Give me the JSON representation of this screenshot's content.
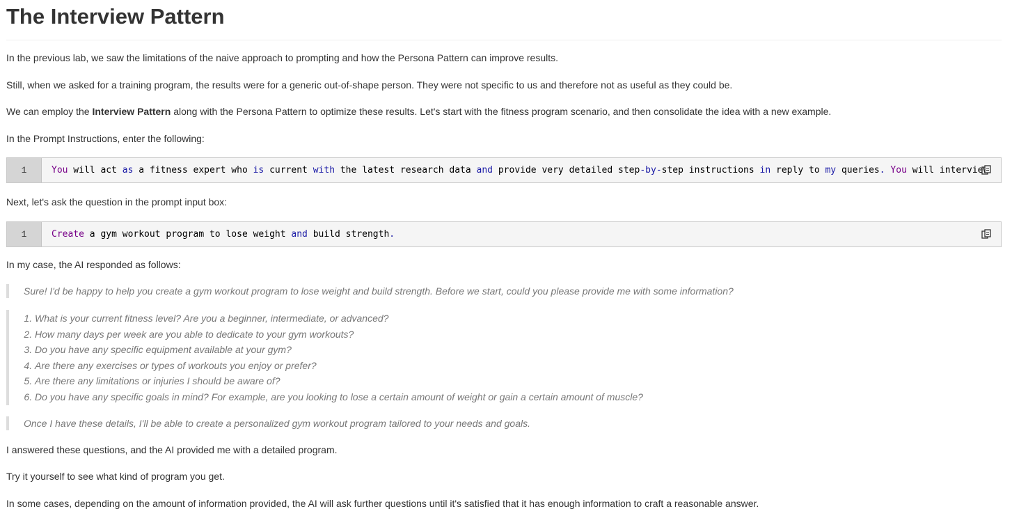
{
  "title": "The Interview Pattern",
  "paragraphs": {
    "p1": "In the previous lab, we saw the limitations of the naive approach to prompting and how the Persona Pattern can improve results.",
    "p2": "Still, when we asked for a training program, the results were for a generic out-of-shape person. They were not specific to us and therefore not as useful as they could be.",
    "p3_before": "We can employ the ",
    "p3_bold": "Interview Pattern",
    "p3_after": " along with the Persona Pattern to optimize these results. Let's start with the fitness program scenario, and then consolidate the idea with a new example.",
    "p4": "In the Prompt Instructions, enter the following:",
    "p5": "Next, let's ask the question in the prompt input box:",
    "p6": "In my case, the AI responded as follows:",
    "p7": "I answered these questions, and the AI provided me with a detailed program.",
    "p8": "Try it yourself to see what kind of program you get.",
    "p9": "In some cases, depending on the amount of information provided, the AI will ask further questions until it's satisfied that it has enough information to craft a reasonable answer."
  },
  "code_blocks": [
    {
      "line_number": "1",
      "tokens": [
        {
          "t": "You",
          "c": "kw1"
        },
        {
          "t": " will act ",
          "c": ""
        },
        {
          "t": "as",
          "c": "kw2"
        },
        {
          "t": " a fitness expert who ",
          "c": ""
        },
        {
          "t": "is",
          "c": "kw2"
        },
        {
          "t": " current ",
          "c": ""
        },
        {
          "t": "with",
          "c": "kw2"
        },
        {
          "t": " the latest research data ",
          "c": ""
        },
        {
          "t": "and",
          "c": "kw2"
        },
        {
          "t": " provide very detailed step",
          "c": ""
        },
        {
          "t": "-",
          "c": "kw2"
        },
        {
          "t": "by",
          "c": "kw2"
        },
        {
          "t": "-",
          "c": "kw2"
        },
        {
          "t": "step instructions ",
          "c": ""
        },
        {
          "t": "in",
          "c": "kw2"
        },
        {
          "t": " reply to ",
          "c": ""
        },
        {
          "t": "my",
          "c": "kw2"
        },
        {
          "t": " queries",
          "c": ""
        },
        {
          "t": ".",
          "c": "kw2"
        },
        {
          "t": " ",
          "c": ""
        },
        {
          "t": "You",
          "c": "kw1"
        },
        {
          "t": " will interview",
          "c": ""
        }
      ]
    },
    {
      "line_number": "1",
      "tokens": [
        {
          "t": "Create",
          "c": "kw1"
        },
        {
          "t": " a gym workout program to lose weight ",
          "c": ""
        },
        {
          "t": "and",
          "c": "kw2"
        },
        {
          "t": " build strength",
          "c": ""
        },
        {
          "t": ".",
          "c": "kw2"
        }
      ]
    }
  ],
  "response": {
    "intro": "Sure! I'd be happy to help you create a gym workout program to lose weight and build strength. Before we start, could you please provide me with some information?",
    "questions": [
      "What is your current fitness level? Are you a beginner, intermediate, or advanced?",
      "How many days per week are you able to dedicate to your gym workouts?",
      "Do you have any specific equipment available at your gym?",
      "Are there any exercises or types of workouts you enjoy or prefer?",
      "Are there any limitations or injuries I should be aware of?",
      "Do you have any specific goals in mind? For example, are you looking to lose a certain amount of weight or gain a certain amount of muscle?"
    ],
    "outro": "Once I have these details, I'll be able to create a personalized gym workout program tailored to your needs and goals."
  },
  "icons": {
    "copy": "copy-icon"
  },
  "colors": {
    "keyword_purple": "#770088",
    "keyword_blue": "#1a1aa6",
    "quote_text": "#777777"
  }
}
